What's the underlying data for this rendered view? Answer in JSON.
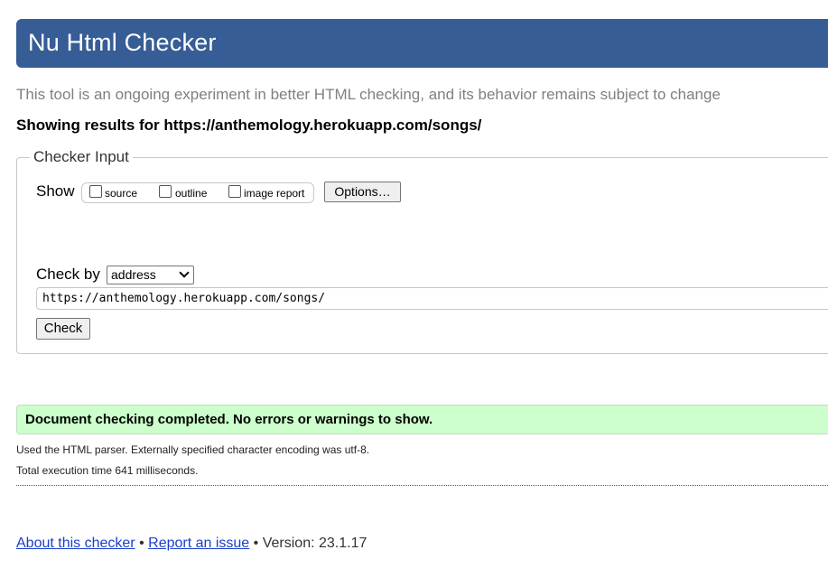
{
  "header": {
    "title": "Nu Html Checker"
  },
  "intro_text": "This tool is an ongoing experiment in better HTML checking, and its behavior remains subject to change",
  "showing_results": "Showing results for https://anthemology.herokuapp.com/songs/",
  "checker_input": {
    "legend": "Checker Input",
    "show_label": "Show",
    "show_options": [
      {
        "label": "source",
        "checked": false
      },
      {
        "label": "outline",
        "checked": false
      },
      {
        "label": "image report",
        "checked": false
      }
    ],
    "options_button": "Options…",
    "check_by_label": "Check by",
    "check_by_selected": "address",
    "url_value": "https://anthemology.herokuapp.com/songs/",
    "check_button": "Check"
  },
  "result": {
    "message": "Document checking completed. No errors or warnings to show.",
    "accent_color": "#ccffcc",
    "details": [
      "Used the HTML parser. Externally specified character encoding was utf-8.",
      "Total execution time 641 milliseconds."
    ]
  },
  "footer": {
    "about_link": "About this checker",
    "separator": "•",
    "report_link": "Report an issue",
    "version_text": "Version: 23.1.17"
  },
  "colors": {
    "header_bg": "#365d95",
    "link": "#1a3fcc"
  }
}
